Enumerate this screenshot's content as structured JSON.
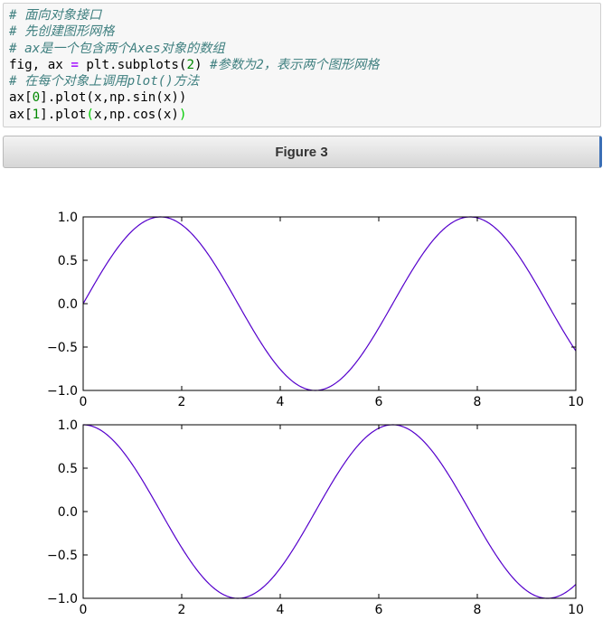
{
  "code_cell": {
    "lines": [
      [
        {
          "t": "# 面向对象接口",
          "c": "comment"
        }
      ],
      [
        {
          "t": "# 先创建图形网格",
          "c": "comment"
        }
      ],
      [
        {
          "t": "# ax是一个包含两个Axes对象的数组",
          "c": "comment"
        }
      ],
      [
        {
          "t": "fig, ax ",
          "c": ""
        },
        {
          "t": "=",
          "c": "op"
        },
        {
          "t": " plt.subplots(",
          "c": ""
        },
        {
          "t": "2",
          "c": "num"
        },
        {
          "t": ") ",
          "c": ""
        },
        {
          "t": "#参数为2，表示两个图形网格",
          "c": "comment"
        }
      ],
      [
        {
          "t": "# 在每个对象上调用plot()方法",
          "c": "comment"
        }
      ],
      [
        {
          "t": "ax[",
          "c": ""
        },
        {
          "t": "0",
          "c": "num"
        },
        {
          "t": "].plot(x,np.sin(x))",
          "c": ""
        }
      ],
      [
        {
          "t": "ax[",
          "c": ""
        },
        {
          "t": "1",
          "c": "num"
        },
        {
          "t": "].plot",
          "c": ""
        },
        {
          "t": "(",
          "c": "bracket-hl"
        },
        {
          "t": "x,np.cos(x)",
          "c": ""
        },
        {
          "t": ")",
          "c": "bracket-hl"
        }
      ]
    ]
  },
  "figure_bar": {
    "title": "Figure 3"
  },
  "colors": {
    "line": "#5500cc"
  },
  "chart_data": [
    {
      "type": "line",
      "function": "sin",
      "x_range": [
        0,
        10
      ],
      "xlim": [
        0,
        10
      ],
      "ylim": [
        -1,
        1
      ],
      "xticks": [
        0,
        2,
        4,
        6,
        8,
        10
      ],
      "yticks": [
        -1.0,
        -0.5,
        0.0,
        0.5,
        1.0
      ],
      "xtick_labels": [
        "0",
        "2",
        "4",
        "6",
        "8",
        "10"
      ],
      "ytick_labels": [
        "−1.0",
        "−0.5",
        "0.0",
        "0.5",
        "1.0"
      ],
      "series": [
        {
          "values_desc": "np.sin(x)"
        }
      ],
      "grid": false
    },
    {
      "type": "line",
      "function": "cos",
      "x_range": [
        0,
        10
      ],
      "xlim": [
        0,
        10
      ],
      "ylim": [
        -1,
        1
      ],
      "xticks": [
        0,
        2,
        4,
        6,
        8,
        10
      ],
      "yticks": [
        -1.0,
        -0.5,
        0.0,
        0.5,
        1.0
      ],
      "xtick_labels": [
        "0",
        "2",
        "4",
        "6",
        "8",
        "10"
      ],
      "ytick_labels": [
        "−1.0",
        "−0.5",
        "0.0",
        "0.5",
        "1.0"
      ],
      "series": [
        {
          "values_desc": "np.cos(x)"
        }
      ],
      "grid": false
    }
  ]
}
